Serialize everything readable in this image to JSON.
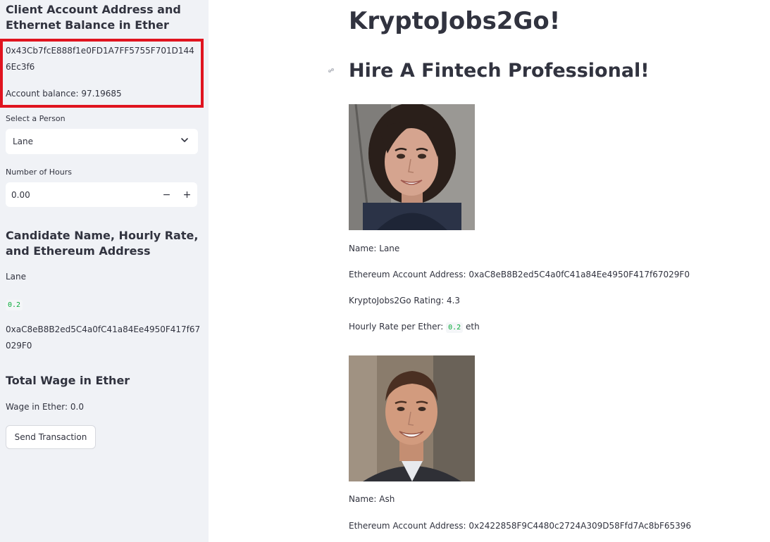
{
  "sidebar": {
    "account_heading": "Client Account Address and Ethernet Balance in Ether",
    "account_address": "0x43Cb7fcE888f1e0FD1A7FF5755F701D1446Ec3f6",
    "account_balance": "Account balance: 97.19685",
    "select_label": "Select a Person",
    "select_value": "Lane",
    "hours_label": "Number of Hours",
    "hours_value": "0.00",
    "hours_minus": "−",
    "hours_plus": "+",
    "candidate_heading": "Candidate Name, Hourly Rate, and Ethereum Address",
    "candidate_name": "Lane",
    "candidate_rate": "0.2",
    "candidate_address": "0xaC8eB8B2ed5C4a0fC41a84Ee4950F417f67029F0",
    "wage_heading": "Total Wage in Ether",
    "wage_text": "Wage in Ether: 0.0",
    "send_button": "Send Transaction"
  },
  "main": {
    "title": "KryptoJobs2Go!",
    "subtitle": "Hire A Fintech Professional!",
    "candidates": [
      {
        "name": "Name: Lane",
        "address": "Ethereum Account Address: 0xaC8eB8B2ed5C4a0fC41a84Ee4950F417f67029F0",
        "rating": "KryptoJobs2Go Rating: 4.3",
        "rate_label": "Hourly Rate per Ether:",
        "rate_value": "0.2",
        "rate_unit": "eth"
      },
      {
        "name": "Name: Ash",
        "address": "Ethereum Account Address: 0x2422858F9C4480c2724A309D58Ffd7Ac8bF65396"
      }
    ]
  },
  "colors": {
    "sidebar_bg": "#f0f2f6",
    "highlight": "#e0141f",
    "code_green": "#09ab3b",
    "text": "#31333f"
  },
  "icons": [
    "chevron-down-icon",
    "link-icon"
  ]
}
